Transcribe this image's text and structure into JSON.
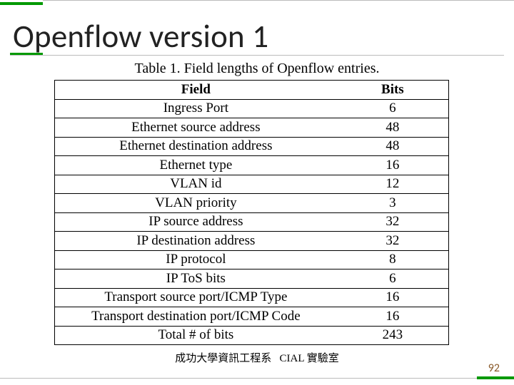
{
  "title": "Openflow version 1",
  "caption_prefix": "Table 1.",
  "caption_rest": " Field lengths of Openflow entries.",
  "header": {
    "field": "Field",
    "bits": "Bits"
  },
  "rows": [
    {
      "field": "Ingress Port",
      "bits": "6"
    },
    {
      "field": "Ethernet source address",
      "bits": "48"
    },
    {
      "field": "Ethernet destination address",
      "bits": "48"
    },
    {
      "field": "Ethernet type",
      "bits": "16"
    },
    {
      "field": "VLAN id",
      "bits": "12"
    },
    {
      "field": "VLAN priority",
      "bits": "3"
    },
    {
      "field": "IP source address",
      "bits": "32"
    },
    {
      "field": "IP destination address",
      "bits": "32"
    },
    {
      "field": "IP protocol",
      "bits": "8"
    },
    {
      "field": "IP ToS bits",
      "bits": "6"
    },
    {
      "field": "Transport source port/ICMP Type",
      "bits": "16"
    },
    {
      "field": "Transport destination port/ICMP Code",
      "bits": "16"
    },
    {
      "field": "Total # of bits",
      "bits": "243"
    }
  ],
  "footer_left": "成功大學資訊工程系",
  "footer_right": "CIAL 實驗室",
  "page_number": "92",
  "chart_data": {
    "type": "table",
    "title": "Table 1. Field lengths of Openflow entries.",
    "columns": [
      "Field",
      "Bits"
    ],
    "data": [
      [
        "Ingress Port",
        6
      ],
      [
        "Ethernet source address",
        48
      ],
      [
        "Ethernet destination address",
        48
      ],
      [
        "Ethernet type",
        16
      ],
      [
        "VLAN id",
        12
      ],
      [
        "VLAN priority",
        3
      ],
      [
        "IP source address",
        32
      ],
      [
        "IP destination address",
        32
      ],
      [
        "IP protocol",
        8
      ],
      [
        "IP ToS bits",
        6
      ],
      [
        "Transport source port/ICMP Type",
        16
      ],
      [
        "Transport destination port/ICMP Code",
        16
      ],
      [
        "Total # of bits",
        243
      ]
    ]
  }
}
